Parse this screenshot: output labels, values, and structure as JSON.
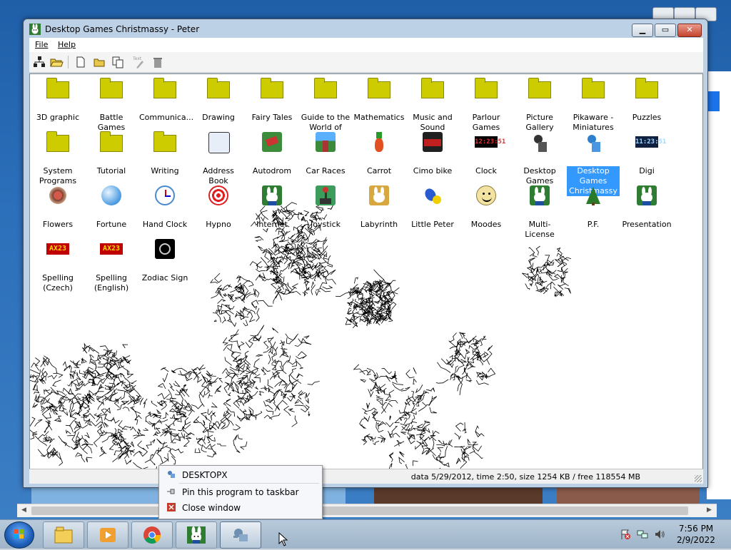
{
  "window": {
    "title": "Desktop Games Christmassy - Peter",
    "menu": [
      "File",
      "Help"
    ],
    "status": "data 5/29/2012, time 2:50, size 1254 KB / free 118554 MB"
  },
  "icons": [
    {
      "label": "3D graphic",
      "kind": "folder"
    },
    {
      "label": "Battle Games",
      "kind": "folder"
    },
    {
      "label": "Communica...",
      "kind": "folder"
    },
    {
      "label": "Drawing",
      "kind": "folder"
    },
    {
      "label": "Fairy Tales",
      "kind": "folder"
    },
    {
      "label": "Guide to the World of Pet...",
      "kind": "folder"
    },
    {
      "label": "Mathematics",
      "kind": "folder"
    },
    {
      "label": "Music and Sound",
      "kind": "folder"
    },
    {
      "label": "Parlour Games",
      "kind": "folder"
    },
    {
      "label": "Picture Gallery",
      "kind": "folder"
    },
    {
      "label": "Pikaware - Miniatures",
      "kind": "folder"
    },
    {
      "label": "Puzzles",
      "kind": "folder"
    },
    {
      "label": "System Programs",
      "kind": "folder"
    },
    {
      "label": "Tutorial",
      "kind": "folder"
    },
    {
      "label": "Writing",
      "kind": "folder"
    },
    {
      "label": "Address Book",
      "kind": "address-book"
    },
    {
      "label": "Autodrom",
      "kind": "autodrom"
    },
    {
      "label": "Car Races",
      "kind": "car-races"
    },
    {
      "label": "Carrot",
      "kind": "carrot"
    },
    {
      "label": "Cimo bike",
      "kind": "bike"
    },
    {
      "label": "Clock",
      "kind": "digital",
      "digits": "12:23:51"
    },
    {
      "label": "Desktop Games",
      "kind": "robot"
    },
    {
      "label": "Desktop Games Christmassy",
      "kind": "robot-blue",
      "selected": true
    },
    {
      "label": "Digi",
      "kind": "digital-blue",
      "digits": "11:23:51"
    },
    {
      "label": "Flowers",
      "kind": "flowers"
    },
    {
      "label": "Fortune",
      "kind": "fortune"
    },
    {
      "label": "Hand Clock",
      "kind": "hand-clock"
    },
    {
      "label": "Hypno",
      "kind": "hypno"
    },
    {
      "label": "Internet",
      "kind": "rabbit"
    },
    {
      "label": "Joystick",
      "kind": "joystick"
    },
    {
      "label": "Labyrinth",
      "kind": "rabbit-yellow"
    },
    {
      "label": "Little Peter",
      "kind": "little-peter"
    },
    {
      "label": "Moodes",
      "kind": "smiley"
    },
    {
      "label": "Multi-License",
      "kind": "rabbit"
    },
    {
      "label": "P.F.",
      "kind": "tree"
    },
    {
      "label": "Presentation",
      "kind": "rabbit"
    },
    {
      "label": "Spelling (Czech)",
      "kind": "ax23",
      "digits": "AX23"
    },
    {
      "label": "Spelling (English)",
      "kind": "ax23",
      "digits": "AX23"
    },
    {
      "label": "Zodiac Sign",
      "kind": "zodiac"
    }
  ],
  "context_menu": {
    "items": [
      "DESKTOPX",
      "Pin this program to taskbar",
      "Close window"
    ]
  },
  "taskbar": {
    "time": "7:56 PM",
    "date": "2/9/2022"
  }
}
